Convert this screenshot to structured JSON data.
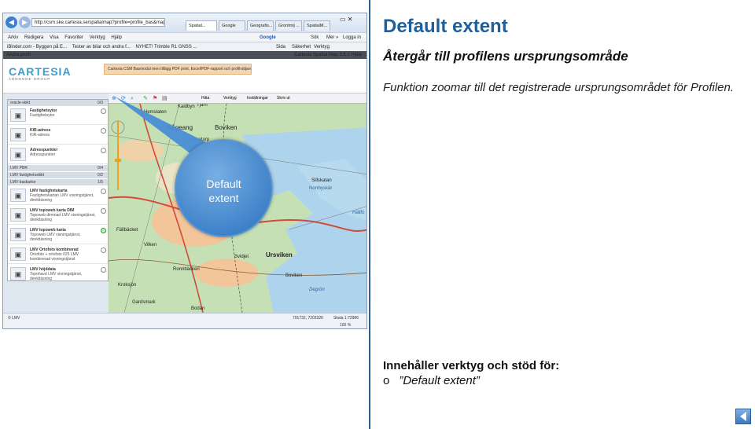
{
  "slide": {
    "title": "Default extent",
    "subtitle": "Återgår till profilens ursprungsområde",
    "description": "Funktion zoomar till det registrerade ursprungsområdet för Profilen.",
    "contains_label": "Innehåller verktyg och stöd för:",
    "bullet_symbol": "o",
    "bullet_text": "”Default extent”",
    "nav_icon": "arrow-left-icon"
  },
  "screenshot": {
    "url": "http://csm.ske.cartesia.se/spatialmap?profile=profile_bas&mapext=77747...",
    "tabs": [
      "Spatial...",
      "Google",
      "Geografis...",
      "Grontmij ...",
      "SpatialM..."
    ],
    "menu": [
      "Arkiv",
      "Redigera",
      "Visa",
      "Favoriter",
      "Verktyg",
      "Hjälp"
    ],
    "google_label": "Google",
    "search_label": "Sök",
    "more_label": "Mer »",
    "login_label": "Logga in",
    "favorites": [
      "iBinder.com - Byggen på E...",
      "Tester av bilar och andra f...",
      "NYHET! Trimble R1 GNSS ..."
    ],
    "fav_tools": [
      "Sida",
      "Säkerhet",
      "Verktyg"
    ],
    "app_header_left": "Ändra profil",
    "app_header_right": "Cartesia Spatial Map 3.6.1   Hjälp",
    "logo": "CARTESIA",
    "logo_sub": "ADDNODE GROUP",
    "promo": "Cartesia CSM Basmodul men tillägg PDF print, Excel/PDF-rapport och profilväljaren",
    "toolbar": [
      "Hitta",
      "Verktyg",
      "Inställningar",
      "Skriv ut"
    ],
    "bubble_text": [
      "Default",
      "extent"
    ],
    "sidebar": {
      "header": "oracle-skikt",
      "header_count": "0/3",
      "items_top": [
        {
          "title": "Fastighetsytor",
          "sub": "Fastighetsytor"
        },
        {
          "title": "KIR-adress",
          "sub": "KIR-adress"
        },
        {
          "title": "Adresspunkter",
          "sub": "Adresspunkter"
        }
      ],
      "groups": [
        {
          "label": "LMV PBR",
          "count": "0/4"
        },
        {
          "label": "LMV fastighetsskikt",
          "count": "0/2"
        },
        {
          "label": "LMV baskartor",
          "count": "1/5"
        }
      ],
      "items_bottom": [
        {
          "title": "LMV fastighetskarta",
          "sub": "Fastighetskartan LMV visningstjänst, direktläsning"
        },
        {
          "title": "LMV topoweb karta DIM",
          "sub": "Topoweb dimmad LMV visningstjänst, direktläsning"
        },
        {
          "title": "LMV topoweb karta",
          "sub": "Topoweb LMV visningstjänst, direktläsning"
        },
        {
          "title": "LMV Ortofoto kombinerad",
          "sub": "Ortofoto + ortofoto 025 LMV kombinerad visningstjänst"
        },
        {
          "title": "LMV höjddata",
          "sub": "Topohavd LMV visningstjänst, direktläsning"
        }
      ]
    },
    "map_labels": [
      "Äckelbo",
      "Hemslaten",
      "Kaldbyn",
      "Tjärn",
      "Kågeang",
      "Boviken",
      "Grännatorp",
      "Sillskatan",
      "Norrbyskär",
      "Bådarna",
      "Hällfo",
      "Fällbäcket",
      "Pitkejten",
      "Vilken",
      "Ursviken",
      "Ronnbäcken",
      "Svidjet",
      "Degrön",
      "Kroksjön",
      "Gardsmark",
      "Boviken",
      "Bodan"
    ],
    "footer_left": "© LMV",
    "footer_coords": "791732, 7203326",
    "footer_scale": "Skala 1:72986",
    "footer_zoom": "100 %"
  }
}
